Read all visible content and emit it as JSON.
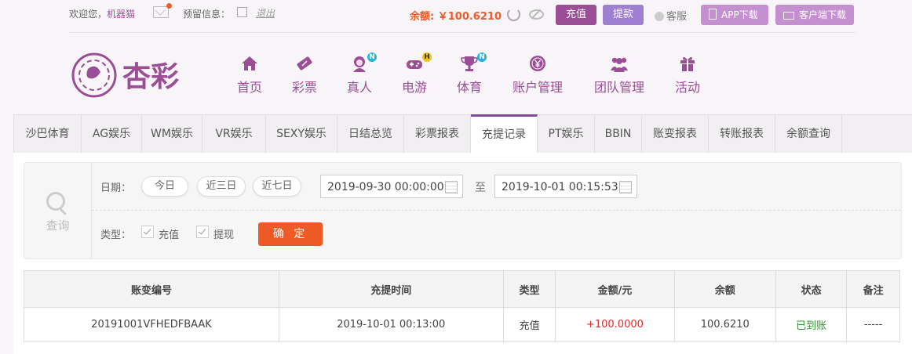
{
  "topbar": {
    "welcome": "欢迎您，",
    "username": "机器猫",
    "reserve_label": "预留信息：",
    "logout": "退出",
    "balance_label": "余额:",
    "balance_value": "￥100.6210",
    "recharge": "充值",
    "withdraw": "提款",
    "service": "客服",
    "app_download": "APP下载",
    "client_download": "客户端下载"
  },
  "logo_text": "杏彩",
  "nav": [
    {
      "label": "首页",
      "icon": "home-icon"
    },
    {
      "label": "彩票",
      "icon": "ticket-icon"
    },
    {
      "label": "真人",
      "icon": "dealer-icon",
      "badge": "N"
    },
    {
      "label": "电游",
      "icon": "gamepad-icon",
      "badge": "H"
    },
    {
      "label": "体育",
      "icon": "trophy-icon",
      "badge": "N"
    },
    {
      "label": "账户管理",
      "icon": "yen-icon"
    },
    {
      "label": "团队管理",
      "icon": "team-icon"
    },
    {
      "label": "活动",
      "icon": "gift-icon"
    }
  ],
  "tabs": [
    "沙巴体育",
    "AG娱乐",
    "WM娱乐",
    "VR娱乐",
    "SEXY娱乐",
    "日结总览",
    "彩票报表",
    "充提记录",
    "PT娱乐",
    "BBIN",
    "账变报表",
    "转账报表",
    "余额查询"
  ],
  "active_tab": "充提记录",
  "query": {
    "label": "查询",
    "date_label": "日期：",
    "today": "今日",
    "three_days": "近三日",
    "seven_days": "近七日",
    "start_date": "2019-09-30 00:00:00",
    "to": "至",
    "end_date": "2019-10-01 00:15:53",
    "type_label": "类型：",
    "type_recharge": "充值",
    "type_withdraw": "提现",
    "confirm": "确 定"
  },
  "table": {
    "headers": [
      "账变编号",
      "充提时间",
      "类型",
      "金额/元",
      "余额",
      "状态",
      "备注"
    ],
    "rows": [
      [
        "20191001VFHEDFBAAK",
        "2019-10-01 00:13:00",
        "充值",
        "+100.0000",
        "100.6210",
        "已到账",
        "-----"
      ]
    ]
  },
  "colors": {
    "brand_purple": "#9b4d96",
    "accent_orange": "#ee5a25",
    "amount_red": "#e02b2b",
    "status_green": "#2e9a2e"
  }
}
